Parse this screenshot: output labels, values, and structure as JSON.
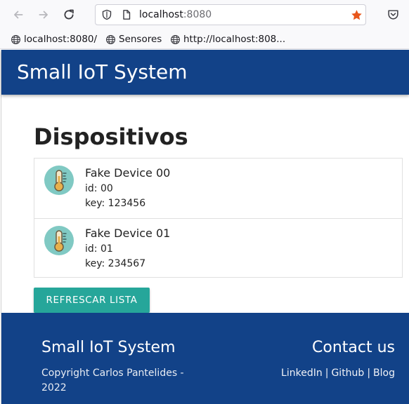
{
  "browser": {
    "url_host": "localhost",
    "url_port": ":8080",
    "bookmarks": [
      {
        "label": "localhost:8080/"
      },
      {
        "label": "Sensores"
      },
      {
        "label": "http://localhost:808..."
      }
    ],
    "colors": {
      "star": "#e8561b",
      "toolbar_bg": "#f9f9fb"
    }
  },
  "app": {
    "brand": "Small IoT System",
    "heading": "Dispositivos",
    "devices": [
      {
        "name": "Fake Device 00",
        "id_line": "id: 00",
        "key_line": "key: 123456",
        "icon": "thermometer-icon"
      },
      {
        "name": "Fake Device 01",
        "id_line": "id: 01",
        "key_line": "key: 234567",
        "icon": "thermometer-icon"
      }
    ],
    "refresh_label": "Refrescar lista",
    "colors": {
      "primary": "#124288",
      "accent": "#26a69a"
    }
  },
  "footer": {
    "title": "Small IoT System",
    "copyright": "Copyright Carlos Pantelides - 2022",
    "contact_title": "Contact us",
    "links": [
      "LinkedIn",
      "Github",
      "Blog"
    ]
  }
}
